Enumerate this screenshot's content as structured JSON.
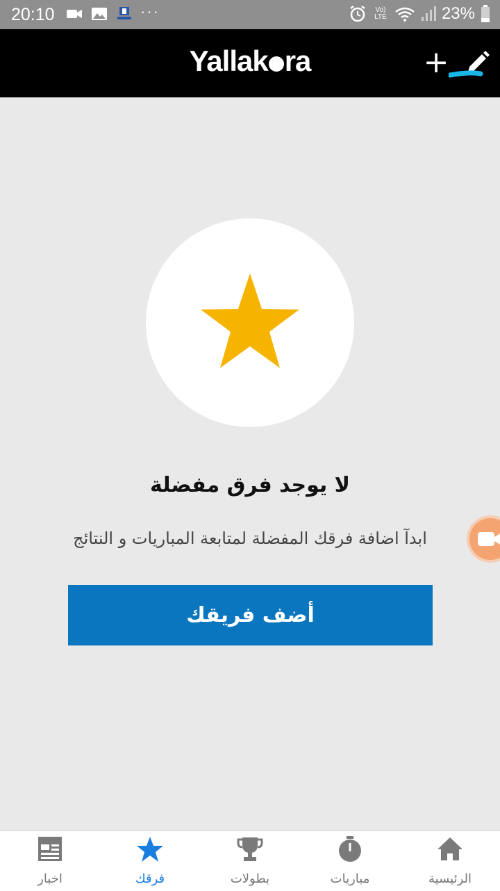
{
  "status_bar": {
    "time": "20:10",
    "battery": "23%",
    "volte_top": "Vo)",
    "volte_bottom": "LTE",
    "dots": "···"
  },
  "header": {
    "logo_before": "Yallak",
    "logo_after": "ra",
    "add_symbol": "+",
    "edit_icon": "pencil-icon"
  },
  "empty_state": {
    "title": "لا يوجد فرق مفضلة",
    "subtitle": "ابدآ اضافة فرقك المفضلة لمتابعة المباريات و النتائج",
    "button_label": "أضف فريقك",
    "star_color": "#F6B400"
  },
  "bottom_nav": {
    "items": [
      {
        "label": "اخبار",
        "icon": "news-icon"
      },
      {
        "label": "فرقك",
        "icon": "star-icon",
        "active": true
      },
      {
        "label": "بطولات",
        "icon": "trophy-icon"
      },
      {
        "label": "مباريات",
        "icon": "stopwatch-icon"
      },
      {
        "label": "الرئيسية",
        "icon": "home-icon"
      }
    ]
  },
  "colors": {
    "accent": "#0A76BF",
    "active_nav": "#1A7DE0",
    "header_bg": "#000000",
    "page_bg": "#E9E9E9"
  }
}
